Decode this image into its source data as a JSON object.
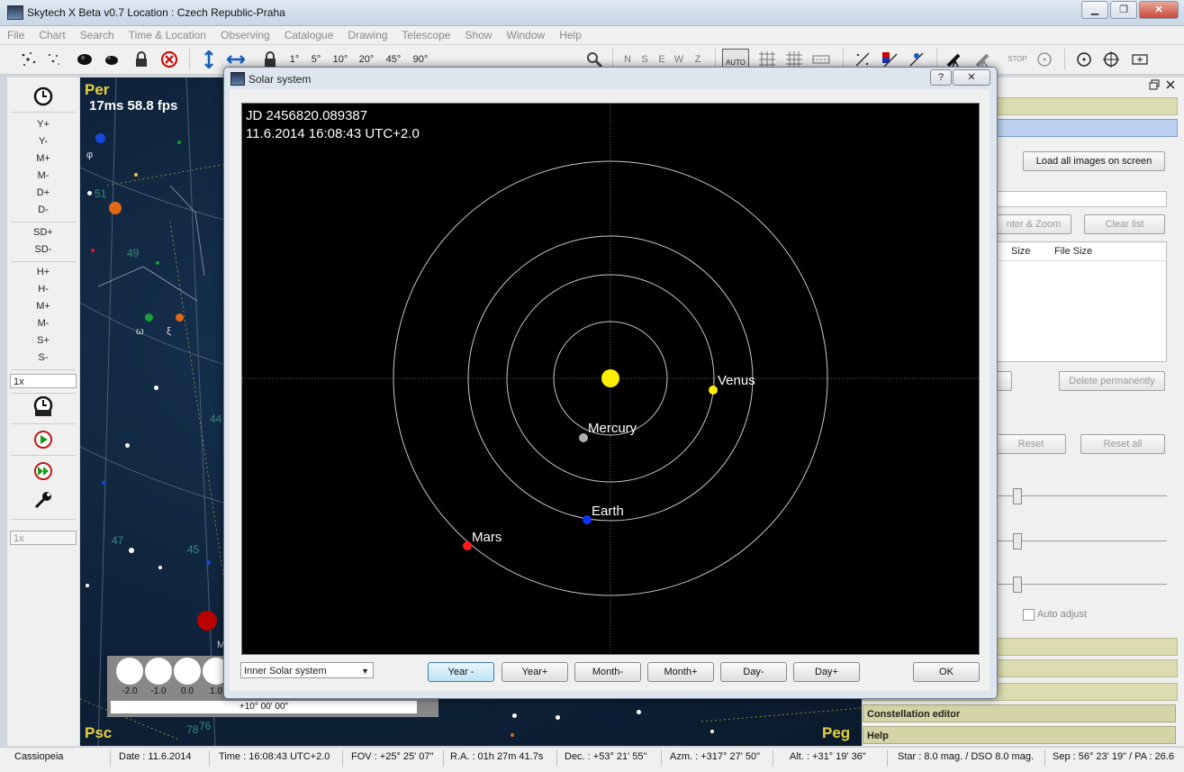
{
  "window": {
    "title": "Skytech X Beta v0.7   Location : Czech Republic-Praha",
    "buttons": [
      "▁",
      "❐",
      "✕"
    ]
  },
  "menu": [
    "File",
    "Chart",
    "Search",
    "Time & Location",
    "Observing",
    "Catalogue",
    "Drawing",
    "Telescope",
    "Show",
    "Window",
    "Help"
  ],
  "toolbar": {
    "fov_buttons": [
      "1°",
      "5°",
      "10°",
      "20°",
      "45°",
      "90°"
    ],
    "compass": [
      "N",
      "S",
      "E",
      "W",
      "Z"
    ],
    "auto_label": "AUTO",
    "stop_label": "STOP"
  },
  "left_panel": {
    "buttons": [
      "Y+",
      "Y-",
      "M+",
      "M-",
      "D+",
      "D-",
      "SD+",
      "SD-",
      "H+",
      "H-",
      "M+",
      "M-",
      "S+",
      "S-"
    ],
    "speed_value": "1x",
    "speed_value_2": "1x",
    "now_label": "NOW"
  },
  "sky": {
    "constellations": {
      "per": "Per",
      "psc": "Psc",
      "peg": "Peg"
    },
    "fps": "17ms 58.8 fps",
    "numbers": {
      "n51": "51",
      "n49": "49",
      "n44": "44",
      "n47": "47",
      "n45": "45",
      "n78": "78",
      "n76": "76"
    },
    "greek": {
      "phi": "φ",
      "omega": "ω",
      "xi": "ξ",
      "m": "M"
    },
    "magnitude_legend": {
      "labels": [
        "-2.0",
        "-1.0",
        "0.0",
        "1.0"
      ],
      "scale": "+10° 00' 00\""
    }
  },
  "right_panel": {
    "load_all_images": "Load all images on screen",
    "center_zoom": "nter & Zoom",
    "clear_list": "Clear list",
    "columns": {
      "size": "Size",
      "file_size": "File Size"
    },
    "delete_permanently": "Delete permanently",
    "reset": "Reset",
    "reset_all": "Reset all",
    "auto_adjust": "Auto adjust",
    "constellation_editor": "Constellation editor",
    "help": "Help"
  },
  "dialog": {
    "title": "Solar system",
    "help_button": "?",
    "close_button": "✕",
    "jd": "JD 2456820.089387",
    "datetime": "11.6.2014 16:08:43 UTC+2.0",
    "planets": {
      "venus": "Venus",
      "mercury": "Mercury",
      "earth": "Earth",
      "mars": "Mars"
    },
    "combo_value": "Inner Solar system",
    "buttons": {
      "year_minus": "Year -",
      "year_plus": "Year+",
      "month_minus": "Month-",
      "month_plus": "Month+",
      "day_minus": "Day-",
      "day_plus": "Day+",
      "ok": "OK"
    }
  },
  "status": {
    "constellation": "Cassiopeia",
    "date": "Date : 11.6.2014",
    "time": "Time : 16:08:43 UTC+2.0",
    "fov": "FOV : +25° 25' 07\"",
    "ra": "R.A. : 01h 27m 41.7s",
    "dec": "Dec. : +53° 21' 55\"",
    "azm": "Azm. : +317° 27' 50\"",
    "alt": "Alt. : +31° 19' 36\"",
    "mag": "Star : 8.0 mag. / DSO 8.0 mag.",
    "sep": "Sep : 56° 23' 19\" / PA : 26.6"
  },
  "colors": {
    "sun": "#ffee00",
    "venus": "#ffee00",
    "mercury": "#b0b0b0",
    "earth": "#1133ff",
    "mars": "#ff1a1a",
    "sky_label": "#e7d23c"
  }
}
